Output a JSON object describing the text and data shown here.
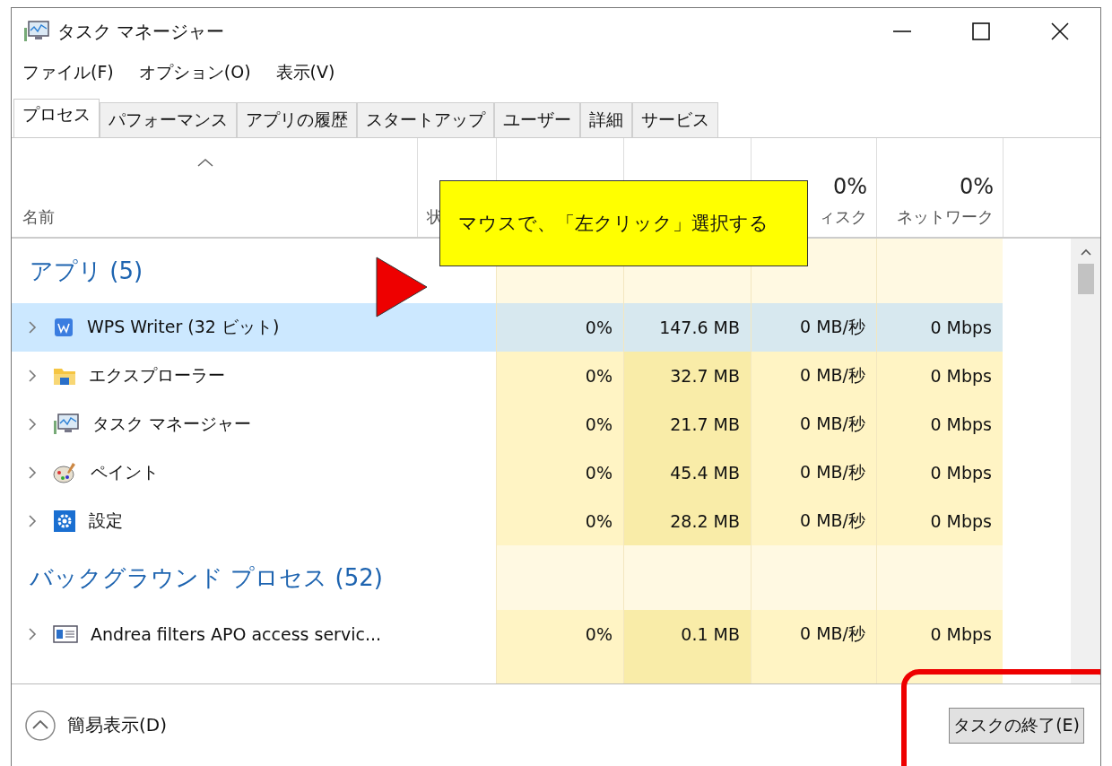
{
  "window": {
    "title": "タスク マネージャー"
  },
  "menu": [
    "ファイル(F)",
    "オプション(O)",
    "表示(V)"
  ],
  "tabs": [
    {
      "label": "プロセス",
      "selected": true
    },
    {
      "label": "パフォーマンス",
      "selected": false
    },
    {
      "label": "アプリの履歴",
      "selected": false
    },
    {
      "label": "スタートアップ",
      "selected": false
    },
    {
      "label": "ユーザー",
      "selected": false
    },
    {
      "label": "詳細",
      "selected": false
    },
    {
      "label": "サービス",
      "selected": false
    }
  ],
  "columns": {
    "name": "名前",
    "status": "状",
    "disk_percent": "0%",
    "disk": "ィスク",
    "network_percent": "0%",
    "network": "ネットワーク"
  },
  "groups": [
    {
      "title": "アプリ (5)",
      "rows": [
        {
          "kind": "writer",
          "name": "WPS Writer (32 ビット)",
          "cpu": "0%",
          "memory": "147.6 MB",
          "disk": "0 MB/秒",
          "network": "0 Mbps",
          "selected": true
        },
        {
          "kind": "explorer",
          "name": "エクスプローラー",
          "cpu": "0%",
          "memory": "32.7 MB",
          "disk": "0 MB/秒",
          "network": "0 Mbps",
          "selected": false
        },
        {
          "kind": "taskmgr",
          "name": "タスク マネージャー",
          "cpu": "0%",
          "memory": "21.7 MB",
          "disk": "0 MB/秒",
          "network": "0 Mbps",
          "selected": false
        },
        {
          "kind": "paint",
          "name": "ペイント",
          "cpu": "0%",
          "memory": "45.4 MB",
          "disk": "0 MB/秒",
          "network": "0 Mbps",
          "selected": false
        },
        {
          "kind": "settings",
          "name": "設定",
          "cpu": "0%",
          "memory": "28.2 MB",
          "disk": "0 MB/秒",
          "network": "0 Mbps",
          "selected": false
        }
      ]
    },
    {
      "title": "バックグラウンド プロセス (52)",
      "rows": [
        {
          "kind": "service",
          "name": "Andrea filters APO access servic...",
          "cpu": "0%",
          "memory": "0.1 MB",
          "disk": "0 MB/秒",
          "network": "0 Mbps",
          "selected": false
        }
      ]
    }
  ],
  "footer": {
    "fewer_details": "簡易表示(D)",
    "end_task": "タスクの終了(E)"
  },
  "callout": {
    "text": "マウスで、「左クリック」選択する"
  }
}
